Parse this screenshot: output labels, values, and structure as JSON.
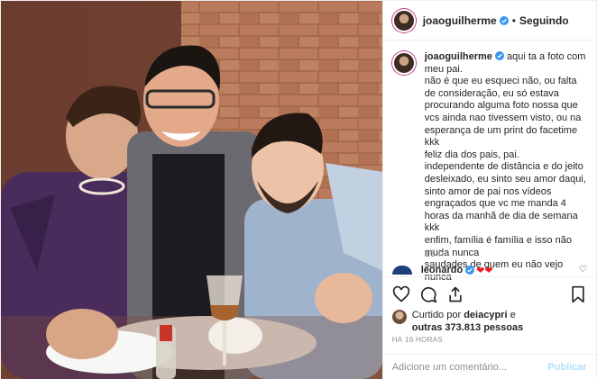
{
  "header": {
    "username": "joaoguilherme",
    "separator": "•",
    "follow_status": "Seguindo"
  },
  "caption": {
    "username": "joaoguilherme",
    "first_line": "aqui ta a foto com meu pai.",
    "body": "não é que eu esqueci não, ou falta de consideração, eu só estava procurando alguma foto nossa que vcs ainda nao tivessem visto, ou na esperança de um print do facetime kkk\nfeliz dia dos pais, pai.\nindependente de distância e do jeito desleixado, eu sinto seu amor daqui, sinto amor de pai nos vídeos engraçados que vc me manda 4 horas da manhã de dia de semana kkk\nenfim, família é família e isso não muda nunca\nsaudades de quem eu não vejo nunca",
    "time": "16 h"
  },
  "comment": {
    "username": "leonardo",
    "text": "❤❤"
  },
  "likes": {
    "prefix": "Curtido por",
    "user": "deiacypri",
    "connector": "e",
    "others": "outras 373.813 pessoas"
  },
  "posted_ago": "HÁ 16 HORAS",
  "add_comment": {
    "placeholder": "Adicione um comentário...",
    "publish": "Publicar"
  },
  "colors": {
    "verified": "#3897f0",
    "heart": "#ed1c24",
    "publish_disabled": "#b2dffc",
    "muted": "#8e8e8e"
  }
}
